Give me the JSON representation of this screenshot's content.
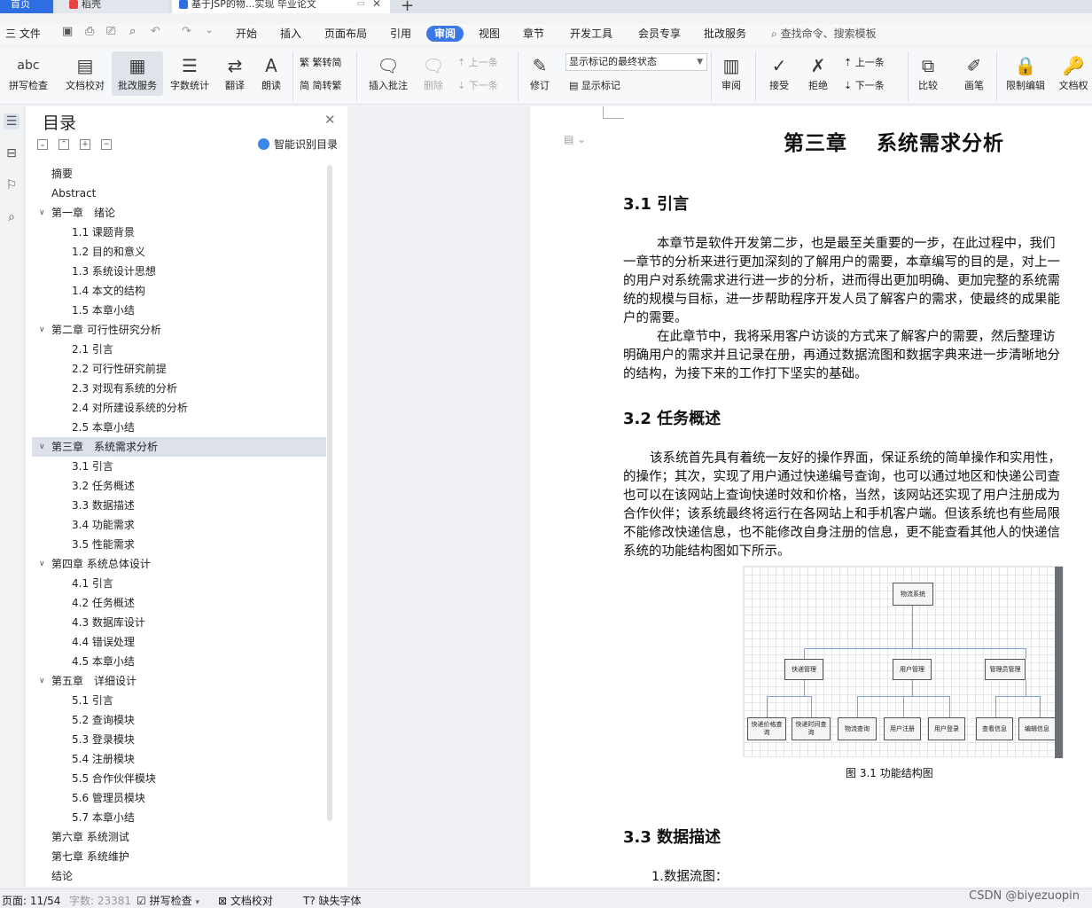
{
  "tabs": [
    {
      "label": "首页"
    },
    {
      "label": "稻壳"
    },
    {
      "label": "基于JSP的物...实现 毕业论文"
    }
  ],
  "menu": {
    "file": "三 文件",
    "items": [
      "开始",
      "插入",
      "页面布局",
      "引用",
      "审阅",
      "视图",
      "章节",
      "开发工具",
      "会员专享",
      "批改服务"
    ],
    "search": "查找命令、搜索模板"
  },
  "ribbon": {
    "spell": "拼写检查",
    "doccheck": "文档校对",
    "review_service": "批改服务",
    "wordcount": "字数统计",
    "translate": "翻译",
    "read": "朗读",
    "trad2simp": "繁转简",
    "simp2trad": "简转繁",
    "insert_comment": "插入批注",
    "delete": "删除",
    "prev": "上一条",
    "next": "下一条",
    "revise": "修订",
    "show_mode": "显示标记的最终状态",
    "show_marks": "显示标记",
    "review": "审阅",
    "accept": "接受",
    "reject": "拒绝",
    "prev2": "上一条",
    "next2": "下一条",
    "compare": "比较",
    "pen": "画笔",
    "restrict": "限制编辑",
    "docperm": "文档权"
  },
  "toc": {
    "title": "目录",
    "smart": "智能识别目录",
    "items": [
      {
        "text": "摘要",
        "level": 0
      },
      {
        "text": "Abstract",
        "level": 0
      },
      {
        "text": "第一章　绪论",
        "level": 1
      },
      {
        "text": "1.1 课题背景",
        "level": 2
      },
      {
        "text": "1.2 目的和意义",
        "level": 2
      },
      {
        "text": "1.3 系统设计思想",
        "level": 2
      },
      {
        "text": "1.4 本文的结构",
        "level": 2
      },
      {
        "text": "1.5 本章小结",
        "level": 2
      },
      {
        "text": "第二章  可行性研究分析",
        "level": 1
      },
      {
        "text": "2.1 引言",
        "level": 2
      },
      {
        "text": "2.2 可行性研究前提",
        "level": 2
      },
      {
        "text": "2.3 对现有系统的分析",
        "level": 2
      },
      {
        "text": "2.4 对所建设系统的分析",
        "level": 2
      },
      {
        "text": "2.5 本章小结",
        "level": 2
      },
      {
        "text": "第三章　系统需求分析",
        "level": 1,
        "selected": true
      },
      {
        "text": "3.1 引言",
        "level": 2
      },
      {
        "text": "3.2 任务概述",
        "level": 2
      },
      {
        "text": "3.3 数据描述",
        "level": 2
      },
      {
        "text": "3.4 功能需求",
        "level": 2
      },
      {
        "text": "3.5 性能需求",
        "level": 2
      },
      {
        "text": "第四章  系统总体设计",
        "level": 1
      },
      {
        "text": "4.1 引言",
        "level": 2
      },
      {
        "text": "4.2 任务概述",
        "level": 2
      },
      {
        "text": "4.3 数据库设计",
        "level": 2
      },
      {
        "text": "4.4 错误处理",
        "level": 2
      },
      {
        "text": "4.5 本章小结",
        "level": 2
      },
      {
        "text": "第五章　详细设计",
        "level": 1
      },
      {
        "text": "5.1 引言",
        "level": 2
      },
      {
        "text": "5.2 查询模块",
        "level": 2
      },
      {
        "text": "5.3 登录模块",
        "level": 2
      },
      {
        "text": "5.4  注册模块",
        "level": 2
      },
      {
        "text": "5.5 合作伙伴模块",
        "level": 2
      },
      {
        "text": "5.6 管理员模块",
        "level": 2
      },
      {
        "text": "5.7 本章小结",
        "level": 2
      },
      {
        "text": "第六章  系统测试",
        "level": 0
      },
      {
        "text": "第七章  系统维护",
        "level": 0
      },
      {
        "text": "结论",
        "level": 0
      }
    ]
  },
  "document": {
    "chapter": "第三章　 系统需求分析",
    "h_31": "3.1 引言",
    "p1": [
      "本章节是软件开发第二步，也是最至关重要的一步，在此过程中，我们",
      "一章节的分析来进行更加深刻的了解用户的需要，本章编写的目的是，对上一",
      "的用户对系统需求进行进一步的分析，进而得出更加明确、更加完整的系统需",
      "统的规模与目标，进一步帮助程序开发人员了解客户的需求，使最终的成果能",
      "户的需要。"
    ],
    "p2": [
      "在此章节中，我将采用客户访谈的方式来了解客户的需要，然后整理访",
      "明确用户的需求并且记录在册，再通过数据流图和数据字典来进一步清晰地分",
      "的结构，为接下来的工作打下坚实的基础。"
    ],
    "h_32": "3.2 任务概述",
    "p3": [
      "该系统首先具有着统一友好的操作界面，保证系统的简单操作和实用性，",
      "的操作；其次，实现了用户通过快递编号查询，也可以通过地区和快递公司查",
      "也可以在该网站上查询快递时效和价格，当然，该网站还实现了用户注册成为",
      "合作伙伴；该系统最终将运行在各网站上和手机客户端。但该系统也有些局限",
      "不能修改快递信息，也不能修改自身注册的信息，更不能查看其他人的快递信",
      "系统的功能结构图如下所示。"
    ],
    "figure": {
      "root": "物流系统",
      "mid": [
        "快递管理",
        "用户管理",
        "管理员管理"
      ],
      "leaves": [
        "快递价格查询",
        "快递时间查询",
        "物流查询",
        "用户注册",
        "用户登录",
        "查看信息",
        "编辑信息"
      ]
    },
    "caption": "图 3.1  功能结构图",
    "h_33": "3.3 数据描述",
    "p4": "1.数据流图："
  },
  "status": {
    "page": "页面: 11/54",
    "words": "字数: 23381",
    "spell": "拼写检查",
    "doccheck": "文档校对",
    "missing_font": "缺失字体",
    "watermark": "CSDN @biyezuopin"
  },
  "colors": {
    "accent": "#3b78e7",
    "tab_active": "#2e6de2",
    "selected_row": "#dde2ea"
  }
}
